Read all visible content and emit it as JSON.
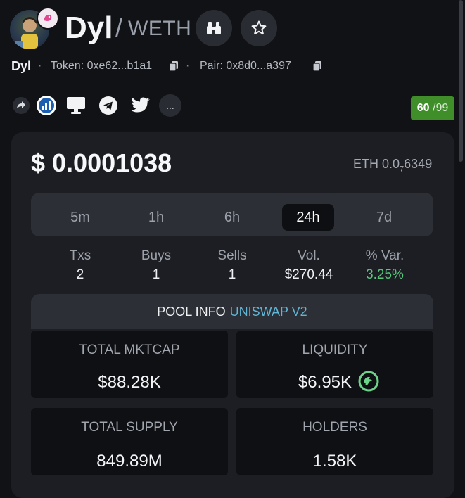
{
  "header": {
    "title": "Dyl",
    "separator": "/",
    "quote": "WETH",
    "binoculars_icon": "binoculars-icon",
    "star_icon": "star-icon"
  },
  "subline": {
    "name": "Dyl",
    "token_label": "Token: 0xe62...b1a1",
    "pair_label": "Pair: 0x8d0...a397"
  },
  "social": {
    "icons": [
      "share-icon",
      "chart-logo-icon",
      "website-icon",
      "telegram-icon",
      "twitter-icon"
    ],
    "more_label": "...",
    "score": "60",
    "score_total": "/99"
  },
  "price": {
    "usd": "$ 0.0001038",
    "eth_prefix": "ETH 0.0",
    "eth_sub": "7",
    "eth_suffix": "6349"
  },
  "tabs": [
    {
      "label": "5m",
      "active": false
    },
    {
      "label": "1h",
      "active": false
    },
    {
      "label": "6h",
      "active": false
    },
    {
      "label": "24h",
      "active": true
    },
    {
      "label": "7d",
      "active": false
    }
  ],
  "stats": [
    {
      "label": "Txs",
      "value": "2"
    },
    {
      "label": "Buys",
      "value": "1"
    },
    {
      "label": "Sells",
      "value": "1"
    },
    {
      "label": "Vol.",
      "value": "$270.44"
    },
    {
      "label": "% Var.",
      "value": "3.25%"
    }
  ],
  "pool": {
    "label": "POOL INFO",
    "dex": "UNISWAP V2"
  },
  "tiles": [
    {
      "label": "TOTAL MKTCAP",
      "value": "$88.28K"
    },
    {
      "label": "LIQUIDITY",
      "value": "$6.95K"
    },
    {
      "label": "TOTAL SUPPLY",
      "value": "849.89M"
    },
    {
      "label": "HOLDERS",
      "value": "1.58K"
    }
  ],
  "colors": {
    "background": "#111216",
    "card": "#1c1e24",
    "positive": "#58c77a",
    "score_bg": "#3f8e2a",
    "dex": "#5fb6d6"
  }
}
